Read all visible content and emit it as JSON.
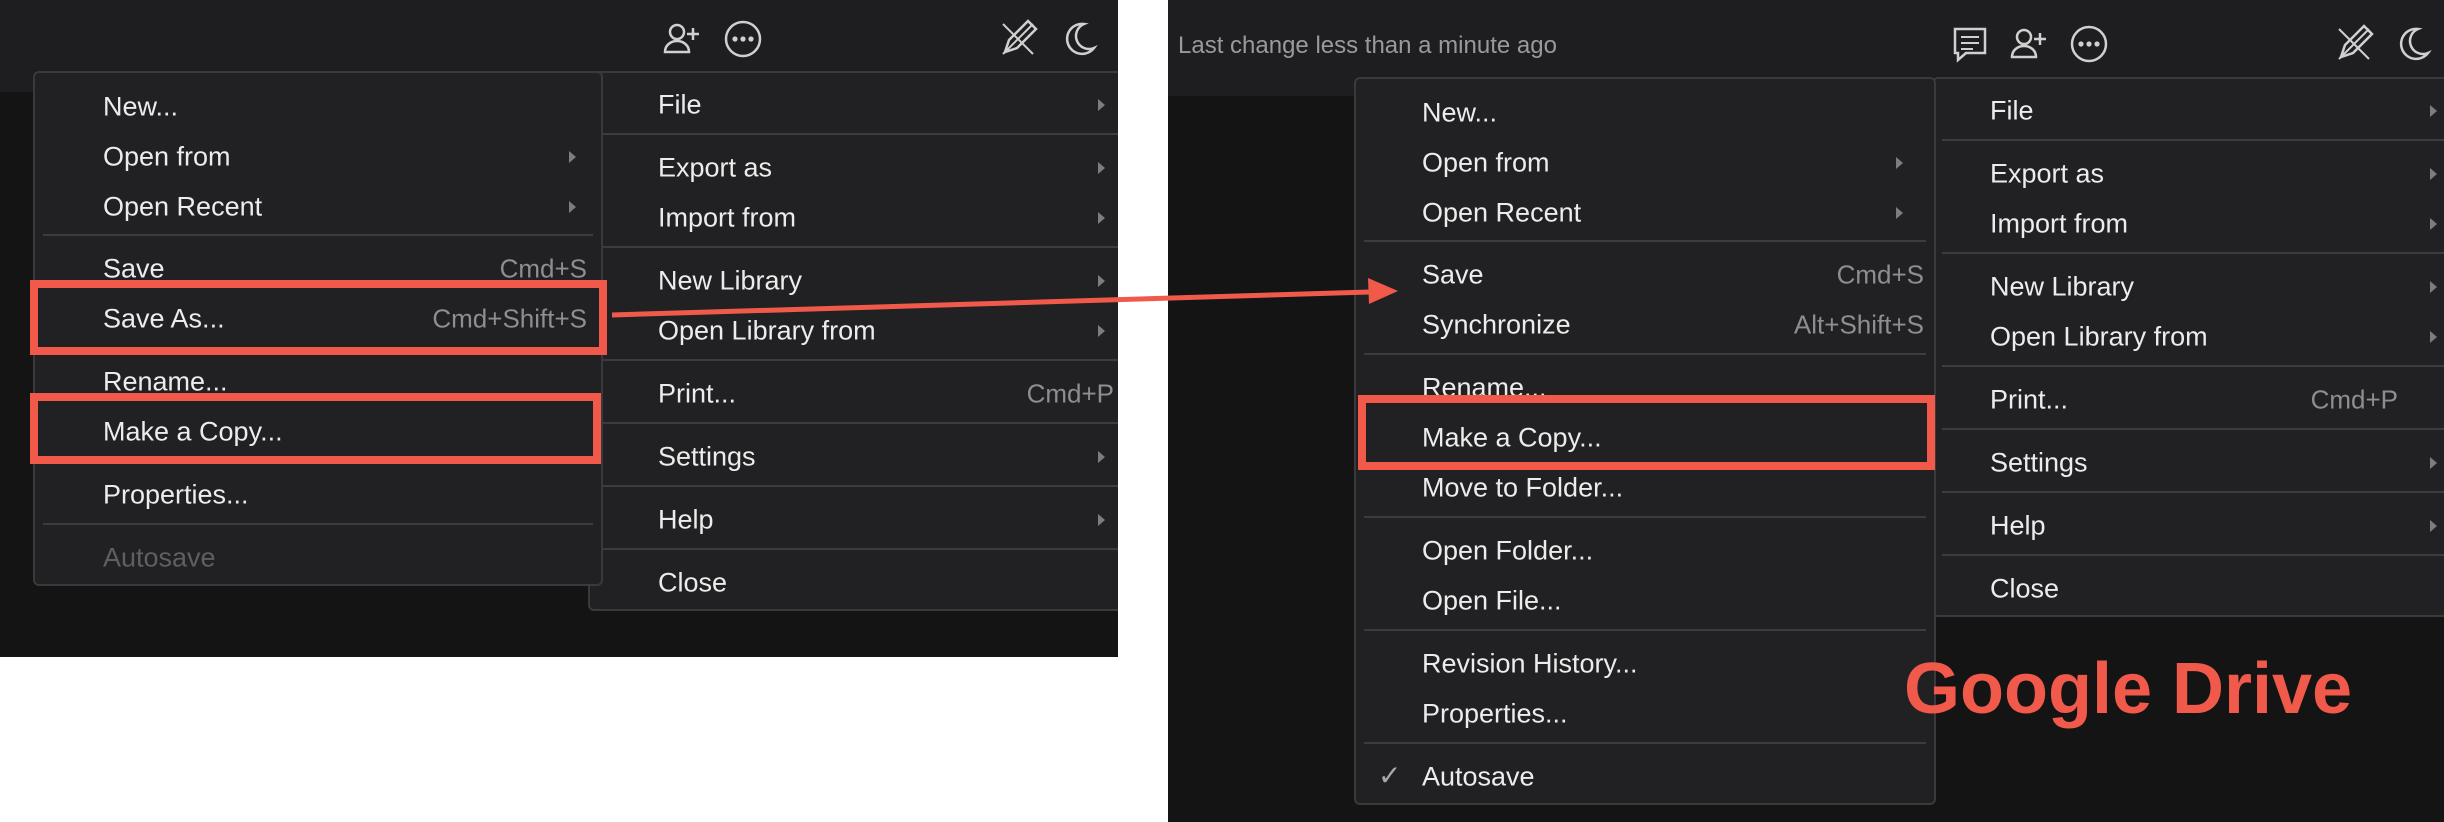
{
  "colors": {
    "highlight": "#f15a4a",
    "menu_bg": "#212123",
    "text": "#ececec",
    "shortcut": "#8e8e90"
  },
  "left": {
    "toolbar_icons": [
      "add-user-icon",
      "more-icon",
      "edit-icon",
      "moon-icon"
    ],
    "file_menu": [
      {
        "label": "New..."
      },
      {
        "label": "Open from"
      },
      {
        "label": "Open Recent"
      },
      {
        "label": "Save",
        "shortcut": "Cmd+S"
      },
      {
        "label": "Save As...",
        "shortcut": "Cmd+Shift+S"
      },
      {
        "label": "Rename..."
      },
      {
        "label": "Make a Copy..."
      },
      {
        "label": "Properties..."
      },
      {
        "label": "Autosave"
      }
    ],
    "main_menu": [
      {
        "label": "File"
      },
      {
        "label": "Export as"
      },
      {
        "label": "Import from"
      },
      {
        "label": "New Library"
      },
      {
        "label": "Open Library from"
      },
      {
        "label": "Print...",
        "shortcut": "Cmd+P"
      },
      {
        "label": "Settings"
      },
      {
        "label": "Help"
      },
      {
        "label": "Close"
      }
    ]
  },
  "right": {
    "status_text": "Last change less than a minute ago",
    "toolbar_icons": [
      "comments-icon",
      "add-user-icon",
      "more-icon",
      "edit-icon",
      "moon-icon"
    ],
    "file_menu": [
      {
        "label": "New..."
      },
      {
        "label": "Open from"
      },
      {
        "label": "Open Recent"
      },
      {
        "label": "Save",
        "shortcut": "Cmd+S"
      },
      {
        "label": "Synchronize",
        "shortcut": "Alt+Shift+S"
      },
      {
        "label": "Rename..."
      },
      {
        "label": "Make a Copy..."
      },
      {
        "label": "Move to Folder..."
      },
      {
        "label": "Open Folder..."
      },
      {
        "label": "Open File..."
      },
      {
        "label": "Revision History..."
      },
      {
        "label": "Properties..."
      },
      {
        "label": "Autosave",
        "checked": true
      }
    ],
    "main_menu": [
      {
        "label": "File"
      },
      {
        "label": "Export as"
      },
      {
        "label": "Import from"
      },
      {
        "label": "New Library"
      },
      {
        "label": "Open Library from"
      },
      {
        "label": "Print...",
        "shortcut": "Cmd+P"
      },
      {
        "label": "Settings"
      },
      {
        "label": "Help"
      },
      {
        "label": "Close"
      }
    ],
    "annotation": "Google Drive"
  }
}
